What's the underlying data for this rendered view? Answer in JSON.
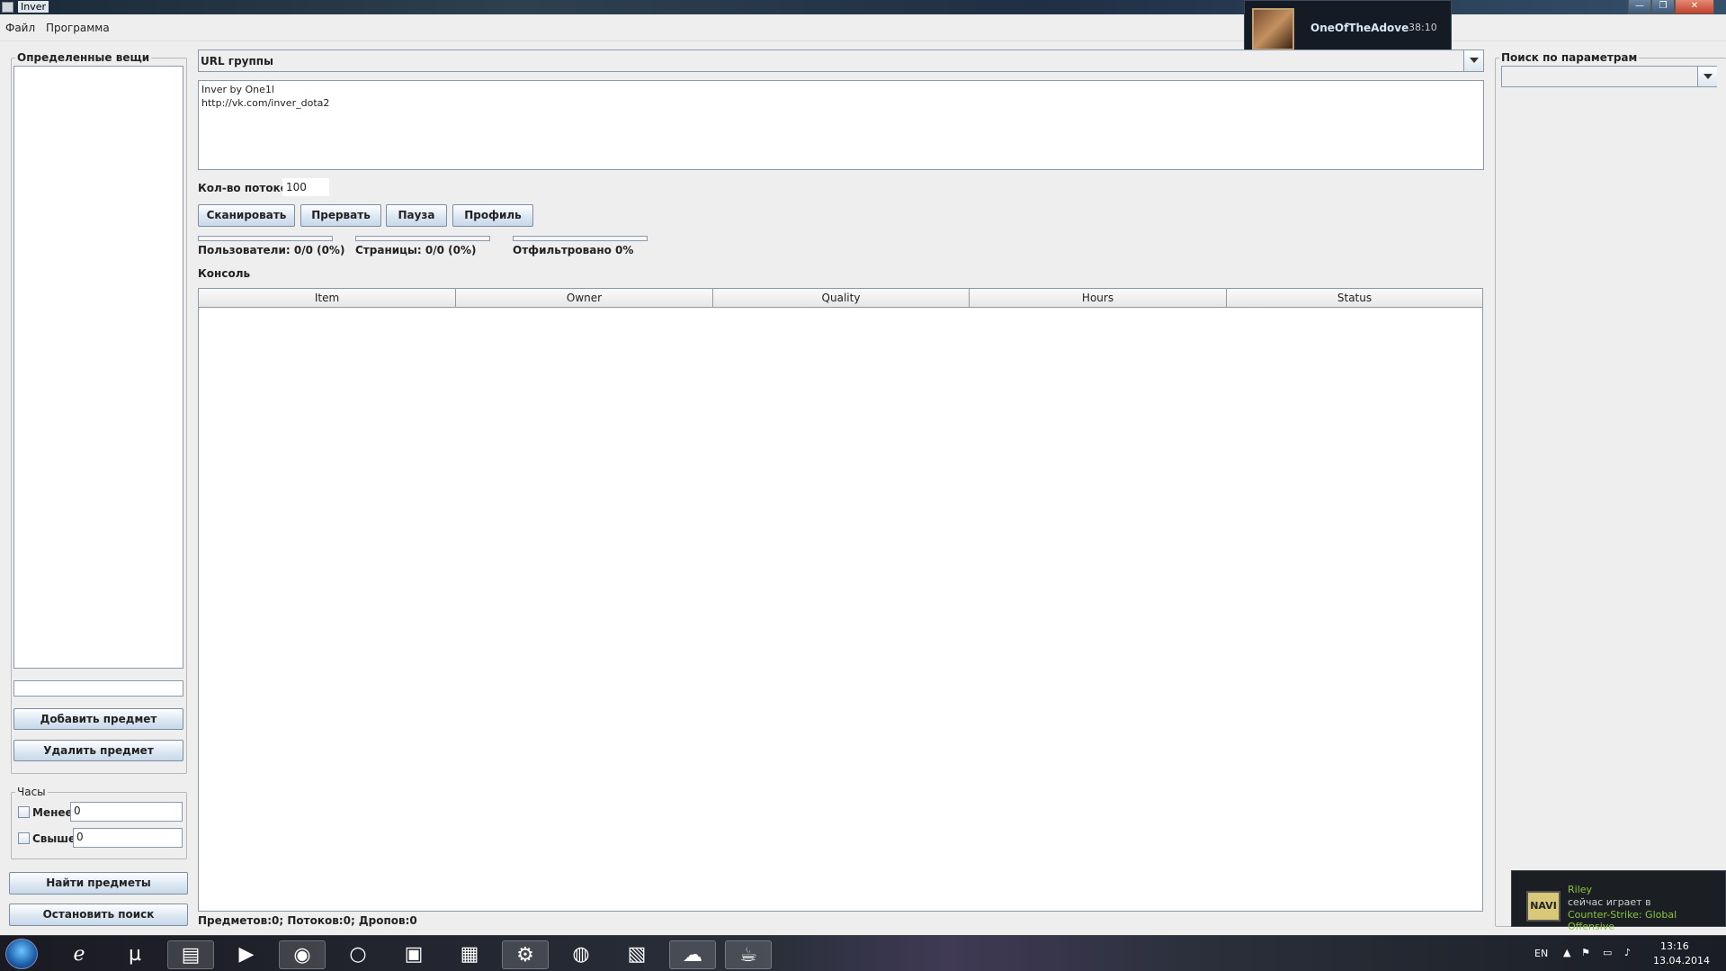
{
  "window": {
    "title": "Inver",
    "minimize": "—",
    "maximize": "❐",
    "close": "✕"
  },
  "menu": [
    "Файл",
    "Программа"
  ],
  "steam_popup": {
    "name": "OneOfTheAdove",
    "time": "38:10"
  },
  "left_panel": {
    "items_group_title": "Определенные вещи",
    "item_input_value": "",
    "add_button": "Добавить предмет",
    "remove_button": "Удалить предмет",
    "hours_group_title": "Часы",
    "less_label": "Менее",
    "less_value": "0",
    "more_label": "Свыше",
    "more_value": "0",
    "find_button": "Найти предметы",
    "stop_button": "Остановить поиск"
  },
  "main": {
    "url_group_label": "URL группы",
    "url_text_line1": "Inver by One1l",
    "url_text_line2": "http://vk.com/inver_dota2",
    "threads_label": "Кол-во потоков:",
    "threads_value": "100",
    "buttons": {
      "scan": "Сканировать",
      "abort": "Прервать",
      "pause": "Пауза",
      "profile": "Профиль"
    },
    "progress": {
      "users_label": "Пользователи: 0/0 (0%)",
      "pages_label": "Страницы: 0/0 (0%)",
      "filtered_label": "Отфильтровано 0%",
      "users_fraction": 0,
      "pages_fraction": 0,
      "filtered_fraction": 0
    },
    "console_label": "Консоль",
    "table_columns": [
      "Item",
      "Owner",
      "Quality",
      "Hours",
      "Status"
    ],
    "status_bar": "Предметов:0; Потоков:0; Дропов:0"
  },
  "right_panel": {
    "search_title": "Поиск по параметрам",
    "search_value": ""
  },
  "friend_toast": {
    "name": "Riley",
    "line2": "сейчас играет в",
    "game": "Counter-Strike: Global Offensive",
    "logo_text": "NAVI"
  },
  "taskbar": {
    "icons": [
      "ie-icon",
      "utorrent-icon",
      "explorer-icon",
      "media-player-icon",
      "chrome-icon",
      "opera-icon",
      "game-icon",
      "photoshop-icon",
      "steam-icon",
      "globe-icon",
      "tool-icon",
      "skype-icon",
      "java-icon"
    ],
    "lang": "EN",
    "time": "13:16",
    "date": "13.04.2014"
  },
  "colors": {
    "steam_green": "#8bc53f",
    "titlebar": "#2d4050",
    "button_border": "#7a8ea6"
  }
}
